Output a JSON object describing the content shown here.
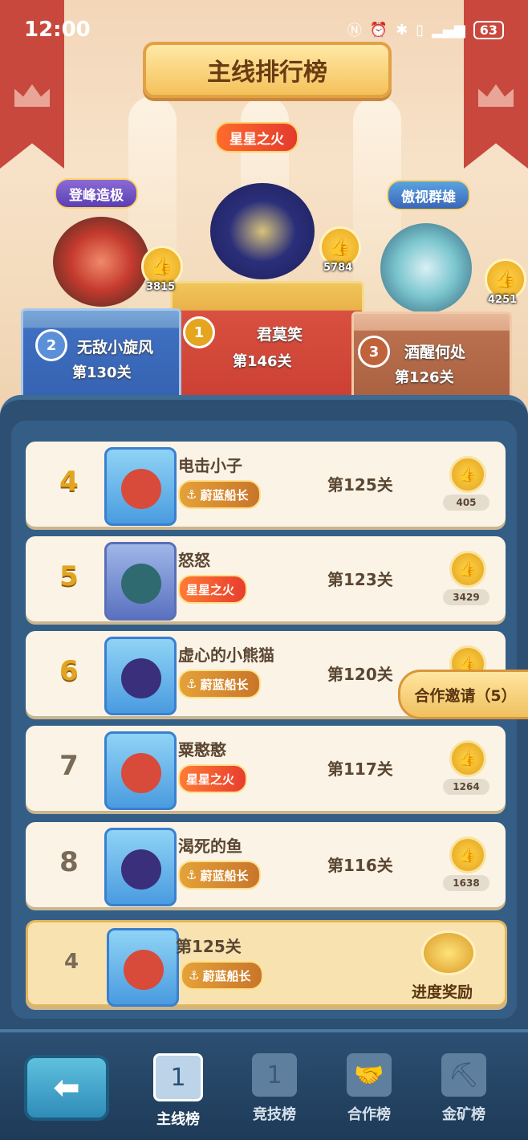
{
  "status_bar": {
    "time": "12:00",
    "battery": "63"
  },
  "header": {
    "title": "主线排行榜"
  },
  "podium": {
    "first": {
      "rank": "1",
      "title_tag": "星星之火",
      "name": "君莫笑",
      "level": "第146关",
      "likes": "5784"
    },
    "second": {
      "rank": "2",
      "title_tag": "登峰造极",
      "name": "无敌小旋风",
      "level": "第130关",
      "likes": "3815"
    },
    "third": {
      "rank": "3",
      "title_tag": "傲视群雄",
      "name": "酒醒何处",
      "level": "第126关",
      "likes": "4251"
    }
  },
  "rows": [
    {
      "rank": "4",
      "name": "电击小子",
      "badge": "蔚蓝船长",
      "stage": "第125关",
      "likes": "405"
    },
    {
      "rank": "5",
      "name": "怒怒",
      "badge": "星星之火",
      "stage": "第123关",
      "likes": "3429"
    },
    {
      "rank": "6",
      "name": "虚心的小熊猫",
      "badge": "蔚蓝船长",
      "stage": "第120关",
      "likes": ""
    },
    {
      "rank": "7",
      "name": "粟憨憨",
      "badge": "星星之火",
      "stage": "第117关",
      "likes": "1264"
    },
    {
      "rank": "8",
      "name": "渴死的鱼",
      "badge": "蔚蓝船长",
      "stage": "第116关",
      "likes": "1638"
    }
  ],
  "my_row": {
    "rank": "4",
    "stage": "第125关",
    "badge": "蔚蓝船长",
    "reward_label": "进度奖励"
  },
  "coop_invite": "合作邀请（5）",
  "nav": {
    "tabs": [
      {
        "label": "主线榜",
        "active": true
      },
      {
        "label": "竞技榜",
        "active": false
      },
      {
        "label": "合作榜",
        "active": false
      },
      {
        "label": "金矿榜",
        "active": false
      }
    ]
  },
  "colors": {
    "accent_gold": "#e3a51f",
    "panel_blue": "#2c4f72",
    "card_bg": "#fbf4e6"
  }
}
